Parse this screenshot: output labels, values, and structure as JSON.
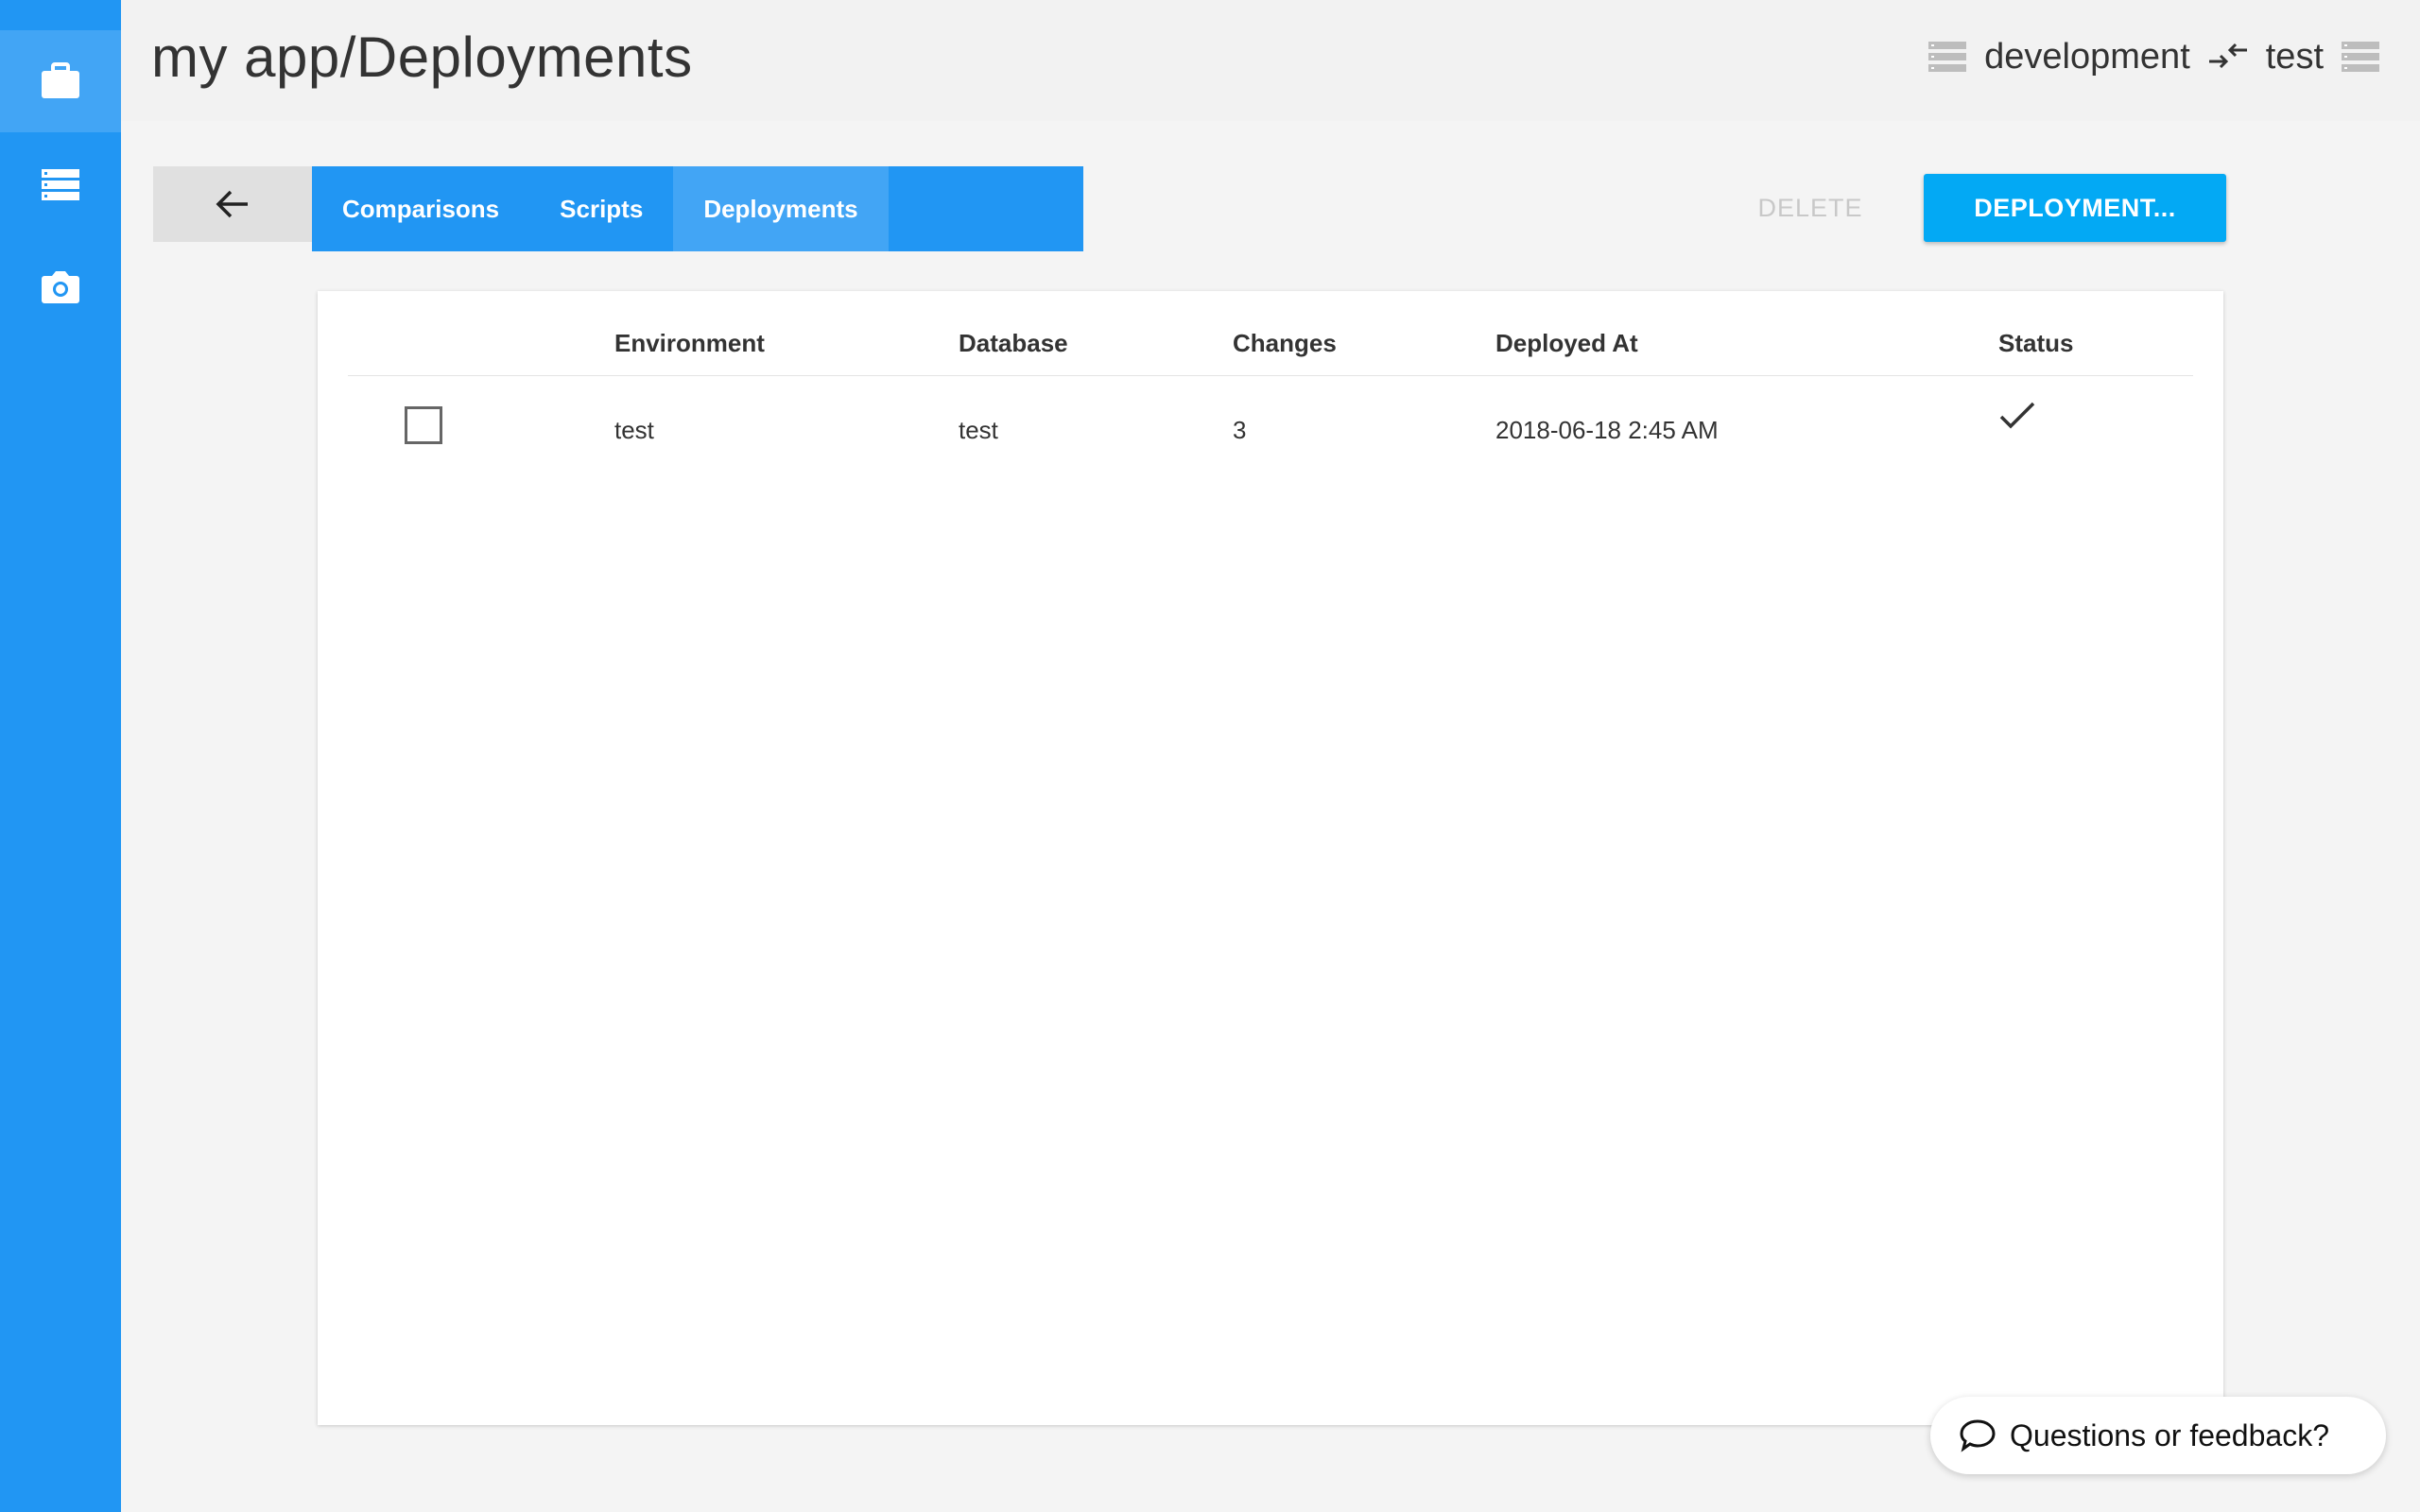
{
  "app": {
    "title": "my app/Deployments"
  },
  "sidebar": {
    "items": [
      {
        "icon": "briefcase-icon",
        "active": true
      },
      {
        "icon": "database-icon",
        "active": false
      },
      {
        "icon": "camera-icon",
        "active": false
      }
    ]
  },
  "header": {
    "source_env": "development",
    "target_env": "test",
    "compare_icon": "arrows-compare-icon"
  },
  "tabs": [
    {
      "label": "Comparisons",
      "active": false
    },
    {
      "label": "Scripts",
      "active": false
    },
    {
      "label": "Deployments",
      "active": true
    }
  ],
  "toolbar": {
    "delete_label": "DELETE",
    "deploy_label": "DEPLOYMENT..."
  },
  "table": {
    "columns": [
      "Environment",
      "Database",
      "Changes",
      "Deployed At",
      "Status"
    ],
    "rows": [
      {
        "checked": false,
        "environment": "test",
        "database": "test",
        "changes": "3",
        "deployed_at": "2018-06-18 2:45 AM",
        "status_icon": "check-icon"
      }
    ]
  },
  "feedback": {
    "label": "Questions or feedback?"
  },
  "colors": {
    "primary": "#2196f3",
    "primary_light": "#42a5f5",
    "accent": "#03a9f4",
    "disabled": "#c8c8c8"
  }
}
